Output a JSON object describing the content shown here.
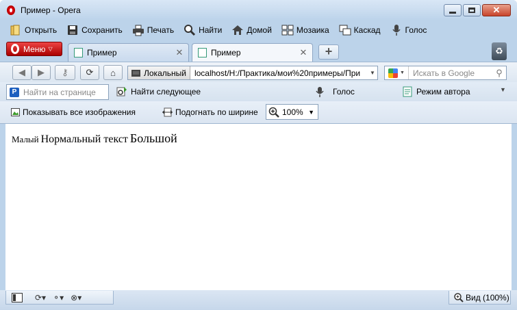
{
  "window": {
    "title": "Пример - Opera"
  },
  "menubar": {
    "items": [
      {
        "label": "Открыть",
        "icon": "folder-open-icon"
      },
      {
        "label": "Сохранить",
        "icon": "save-icon"
      },
      {
        "label": "Печать",
        "icon": "print-icon"
      },
      {
        "label": "Найти",
        "icon": "search-icon"
      },
      {
        "label": "Домой",
        "icon": "home-icon"
      },
      {
        "label": "Мозаика",
        "icon": "tile-icon"
      },
      {
        "label": "Каскад",
        "icon": "cascade-icon"
      },
      {
        "label": "Голос",
        "icon": "microphone-icon"
      }
    ]
  },
  "tabs": {
    "menu_label": "Меню",
    "items": [
      {
        "label": "Пример",
        "active": false
      },
      {
        "label": "Пример",
        "active": true
      }
    ],
    "new_tab": "+"
  },
  "navbar": {
    "address_badge": "Локальный",
    "address_value": "localhost/H:/Практика/мои%20примеры/При",
    "search_placeholder": "Искать в Google"
  },
  "findbar": {
    "find_placeholder": "Найти на странице",
    "find_next": "Найти следующее",
    "voice": "Голос",
    "author_mode": "Режим автора"
  },
  "imagebar": {
    "show_images": "Показывать все изображения",
    "fit_width": "Подогнать по ширине",
    "zoom_value": "100%"
  },
  "content": {
    "small_text": "Малый",
    "normal_text": "Нормальный текст",
    "big_text": "Большой"
  },
  "statusbar": {
    "view_label": "Вид (100%)"
  },
  "colors": {
    "frame": "#bcd3ea",
    "menu_red": "#cc1111",
    "content_bg": "#ffffff"
  }
}
